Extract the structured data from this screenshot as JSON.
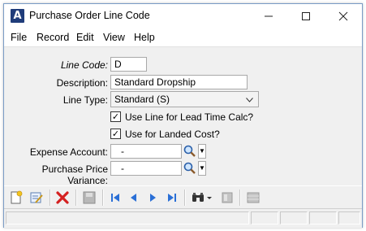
{
  "window": {
    "title": "Purchase Order Line Code",
    "icon": "app-logo-icon"
  },
  "title_controls": {
    "minimize": "—",
    "maximize": "☐",
    "close": "✕"
  },
  "menu": [
    "File",
    "Record",
    "Edit",
    "View",
    "Help"
  ],
  "form": {
    "line_code": {
      "label": "Line Code:",
      "value": "D"
    },
    "description": {
      "label": "Description:",
      "value": "Standard Dropship"
    },
    "line_type": {
      "label": "Line Type:",
      "value": "Standard (S)"
    },
    "lead_time": {
      "label": "Use Line for Lead Time Calc?",
      "checked": true
    },
    "landed_cost": {
      "label": "Use for Landed Cost?",
      "checked": true
    },
    "expense_account": {
      "label": "Expense Account:",
      "value": "-"
    },
    "ppv": {
      "label": "Purchase Price Variance:",
      "value": "-"
    }
  },
  "check_mark": "✓",
  "colors": {
    "accent": "#1f3c7a",
    "nav_blue": "#2a6fd6",
    "delete_red": "#d42020"
  }
}
